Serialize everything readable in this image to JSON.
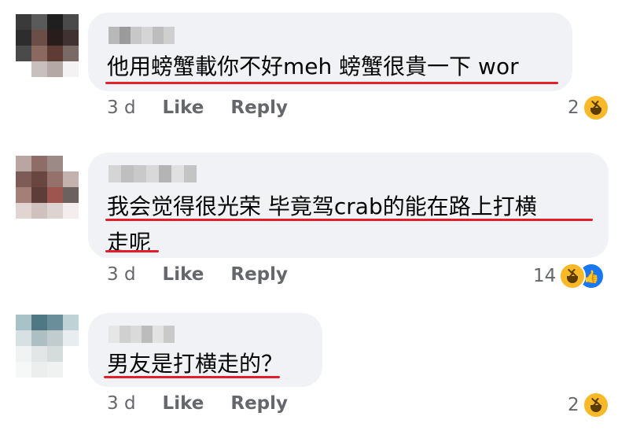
{
  "comments": [
    {
      "lines": [
        "他用螃蟹載你不好meh 螃蟹很貴一下 wor"
      ],
      "time": "3 d",
      "like_label": "Like",
      "reply_label": "Reply",
      "reaction_count": "2",
      "reactions": [
        "haha-icon"
      ]
    },
    {
      "lines": [
        "我会觉得很光荣 毕竟驾crab的能在路上打横",
        "走呢"
      ],
      "time": "3 d",
      "like_label": "Like",
      "reply_label": "Reply",
      "reaction_count": "14",
      "reactions": [
        "haha-icon",
        "like-icon"
      ]
    },
    {
      "lines": [
        "男友是打横走的？"
      ],
      "time": "3 d",
      "like_label": "Like",
      "reply_label": "Reply",
      "reaction_count": "2",
      "reactions": [
        "haha-icon"
      ]
    }
  ],
  "colors": {
    "bubble": "#f0f2f5",
    "underline": "#e41e2c",
    "meta_text": "#65676b",
    "haha": "#f7b928",
    "like": "#1877f2"
  }
}
